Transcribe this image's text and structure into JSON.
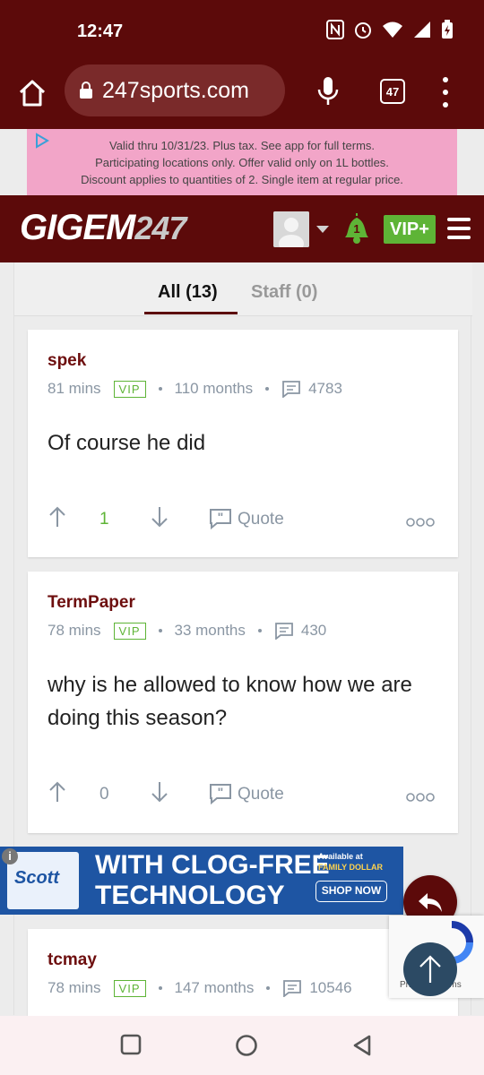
{
  "status_bar": {
    "time": "12:47"
  },
  "browser": {
    "url": "247sports.com",
    "tab_count": "47"
  },
  "ad_top": {
    "lines": [
      "Valid thru 10/31/23. Plus tax. See app for full terms.",
      "Participating locations only. Offer valid only on 1L bottles.",
      "Discount applies to quantities of 2. Single item at regular price."
    ]
  },
  "site": {
    "logo_text": "GIGEM",
    "logo_num": "247",
    "notification_count": "1",
    "vip_label": "VIP+"
  },
  "tabs": [
    {
      "label": "All (13)",
      "active": true
    },
    {
      "label": "Staff (0)",
      "active": false
    }
  ],
  "posts": [
    {
      "user": "spek",
      "time": "81 mins",
      "badge": "VIP",
      "tenure": "110 months",
      "posts": "4783",
      "body": "Of course he did",
      "votes": "1",
      "quote_label": "Quote",
      "vote_color": "#5eb436"
    },
    {
      "user": "TermPaper",
      "time": "78 mins",
      "badge": "VIP",
      "tenure": "33 months",
      "posts": "430",
      "body": "why is he allowed to know how we are doing this season?",
      "votes": "0",
      "quote_label": "Quote",
      "vote_color": "#8a96a3"
    },
    {
      "user": "tcmay",
      "time": "78 mins",
      "badge": "VIP",
      "tenure": "147 months",
      "posts": "10546"
    }
  ],
  "ad_bottom": {
    "headline_1": "WITH CLOG-FREE",
    "headline_2": "TECHNOLOGY",
    "brand": "Scott",
    "available": "Available at",
    "store": "FAMILY DOLLAR",
    "cta": "SHOP NOW"
  },
  "recaptcha": {
    "text": "Privacy - Terms"
  },
  "colors": {
    "brand_maroon": "#5c0a0a",
    "vip_green": "#5eb436",
    "meta_gray": "#8a96a3"
  }
}
